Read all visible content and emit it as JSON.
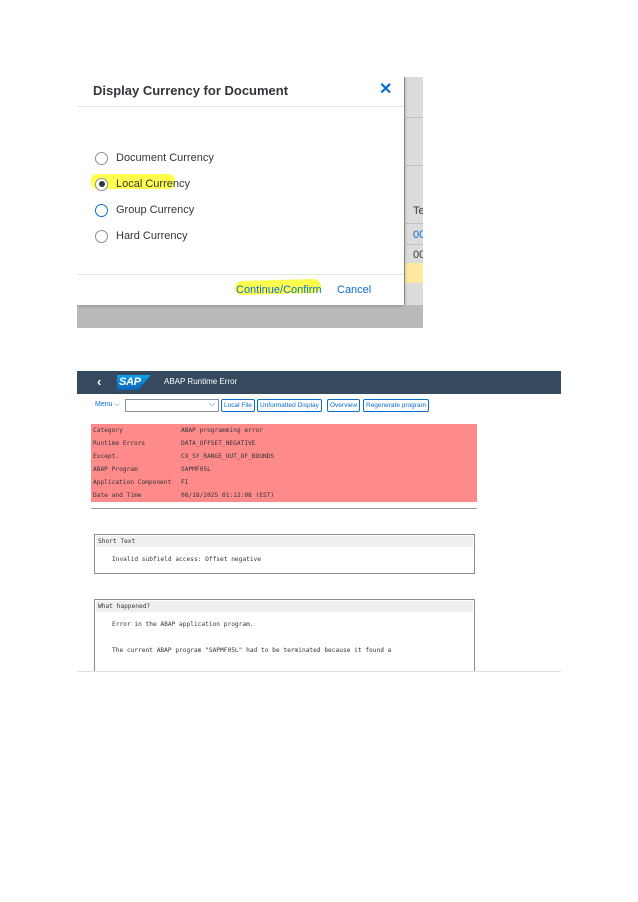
{
  "dialog": {
    "title": "Display Currency for Document",
    "close_icon": "close-icon",
    "options": [
      {
        "label": "Document Currency",
        "selected": false
      },
      {
        "label": "Local Currency",
        "selected": true
      },
      {
        "label": "Group Currency",
        "selected": false
      },
      {
        "label": "Hard Currency",
        "selected": false
      }
    ],
    "continue_label": "Continue/Confirm",
    "cancel_label": "Cancel",
    "highlight_color": "#ffff4d",
    "accent_color": "#0a6ed1",
    "background_fragments": [
      "Te",
      "00",
      "00"
    ]
  },
  "abap": {
    "shell_title": "ABAP Runtime Error",
    "logo_text": "SAP",
    "toolbar": {
      "menu_label": "Menu",
      "select_value": "",
      "buttons": [
        "Local File",
        "Unformatted Display",
        "Overview",
        "Regenerate program"
      ]
    },
    "summary": [
      {
        "key": "Category",
        "value": "ABAP programming error"
      },
      {
        "key": "Runtime Errors",
        "value": "DATA_OFFSET_NEGATIVE"
      },
      {
        "key": "Except.",
        "value": "CX_SY_RANGE_OUT_OF_BOUNDS"
      },
      {
        "key": "ABAP Program",
        "value": "SAPMF05L"
      },
      {
        "key": "Application Component",
        "value": "FI"
      },
      {
        "key": "Date and Time",
        "value": "08/18/2025 01:12:08 (EST)"
      }
    ],
    "summary_color": "#ff8a8a",
    "short_text": {
      "heading": "Short Text",
      "lines": [
        "Invalid subfield access: Offset negative"
      ]
    },
    "what_happened": {
      "heading": "What happened?",
      "lines": [
        "Error in the ABAP application program.",
        "The current ABAP program \"SAPMF05L\" had to be terminated because it found a"
      ]
    },
    "shell_color": "#354a5f"
  }
}
